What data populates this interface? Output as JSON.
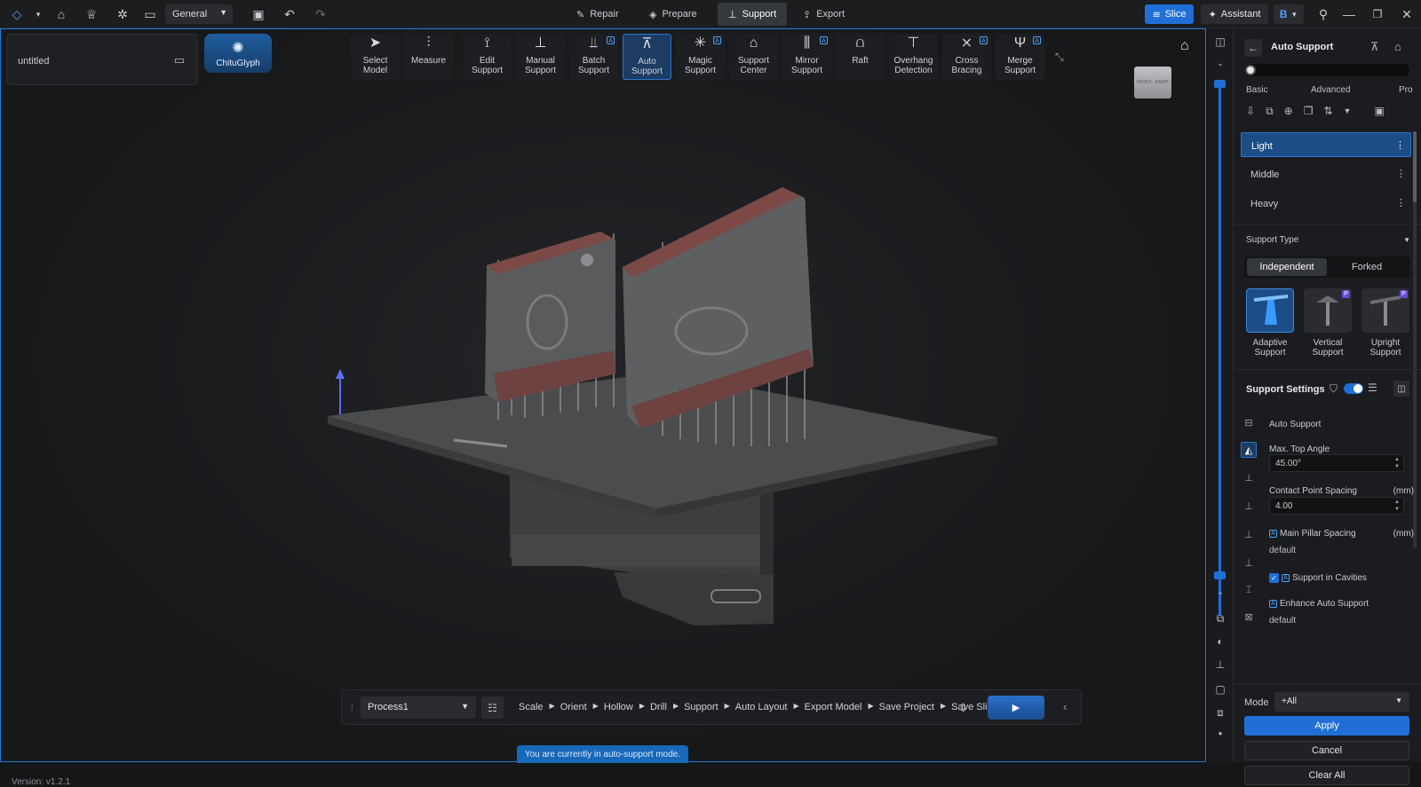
{
  "topbar": {
    "workspace": "General",
    "tabs": [
      {
        "label": "Repair",
        "icon": "wrench-icon"
      },
      {
        "label": "Prepare",
        "icon": "cube-icon"
      },
      {
        "label": "Support",
        "icon": "support-icon",
        "active": true
      },
      {
        "label": "Export",
        "icon": "export-icon"
      }
    ],
    "slice_label": "Slice",
    "assistant_label": "Assistant",
    "profile_letter": "B"
  },
  "viewport": {
    "project_name": "untitled",
    "plugin_label": "ChituGlyph",
    "tools": [
      {
        "label1": "Select",
        "label2": "Model",
        "icon": "cursor-icon"
      },
      {
        "label1": "Measure",
        "label2": "",
        "icon": "ruler-icon"
      },
      {
        "label1": "Edit",
        "label2": "Support",
        "icon": "edit-support-icon"
      },
      {
        "label1": "Manual",
        "label2": "Support",
        "icon": "manual-support-icon"
      },
      {
        "label1": "Batch",
        "label2": "Support",
        "icon": "batch-support-icon",
        "badge": "A"
      },
      {
        "label1": "Auto",
        "label2": "Support",
        "icon": "auto-support-icon",
        "active": true
      },
      {
        "label1": "Magic",
        "label2": "Support",
        "icon": "magic-support-icon",
        "badge": "A"
      },
      {
        "label1": "Support",
        "label2": "Center",
        "icon": "support-center-icon"
      },
      {
        "label1": "Mirror",
        "label2": "Support",
        "icon": "mirror-support-icon",
        "badge": "A"
      },
      {
        "label1": "Raft",
        "label2": "",
        "icon": "raft-icon"
      },
      {
        "label1": "Overhang",
        "label2": "Detection",
        "icon": "overhang-icon"
      },
      {
        "label1": "Cross",
        "label2": "Bracing",
        "icon": "cross-bracing-icon",
        "badge": "A"
      },
      {
        "label1": "Merge",
        "label2": "Support",
        "icon": "merge-support-icon",
        "badge": "A"
      }
    ],
    "viewcube_front": "FRONT",
    "viewcube_right": "RIGHT",
    "process": "Process1",
    "steps": [
      "Scale",
      "Orient",
      "Hollow",
      "Drill",
      "Support",
      "Auto Layout",
      "Export Model",
      "Save Project",
      "Save Slice"
    ],
    "status_message": "You are currently in auto-support mode.",
    "version": "Version: v1.2.1"
  },
  "panel": {
    "title": "Auto Support",
    "slider_labels": [
      "Basic",
      "Advanced",
      "Pro"
    ],
    "presets": [
      "Light",
      "Middle",
      "Heavy"
    ],
    "support_type_title": "Support Type",
    "segments": [
      "Independent",
      "Forked"
    ],
    "types": [
      {
        "label1": "Adaptive",
        "label2": "Support",
        "active": true
      },
      {
        "label1": "Vertical",
        "label2": "Support",
        "pro": "P"
      },
      {
        "label1": "Upright",
        "label2": "Support",
        "pro": "P"
      }
    ],
    "settings_title": "Support Settings",
    "auto_support_label": "Auto Support",
    "max_top_angle_label": "Max. Top Angle",
    "max_top_angle_value": "45.00°",
    "contact_spacing_label": "Contact Point Spacing",
    "contact_spacing_unit": "(mm)",
    "contact_spacing_value": "4.00",
    "main_pillar_label": "Main Pillar Spacing",
    "main_pillar_unit": "(mm)",
    "main_pillar_value": "default",
    "cavities_label": "Support in Cavities",
    "enhance_label": "Enhance Auto Support",
    "enhance_value": "default",
    "mode_label": "Mode",
    "mode_value": "+All",
    "apply_label": "Apply",
    "cancel_label": "Cancel",
    "clear_label": "Clear All"
  }
}
